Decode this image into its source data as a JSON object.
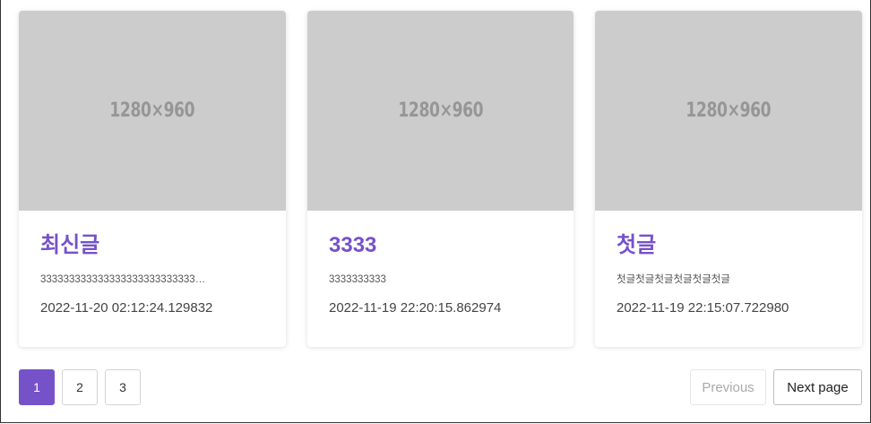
{
  "posts": [
    {
      "image_label": "1280×960",
      "title": "최신글",
      "excerpt": "3333333333333333333333333333...",
      "date": "2022-11-20 02:12:24.129832"
    },
    {
      "image_label": "1280×960",
      "title": "3333",
      "excerpt": "3333333333",
      "date": "2022-11-19 22:20:15.862974"
    },
    {
      "image_label": "1280×960",
      "title": "첫글",
      "excerpt": "첫글첫글첫글첫글첫글첫글",
      "date": "2022-11-19 22:15:07.722980"
    }
  ],
  "pagination": {
    "pages": [
      "1",
      "2",
      "3"
    ],
    "current": "1",
    "previous_label": "Previous",
    "next_label": "Next page"
  },
  "colors": {
    "accent": "#7652c9",
    "placeholder_bg": "#cccccc"
  }
}
